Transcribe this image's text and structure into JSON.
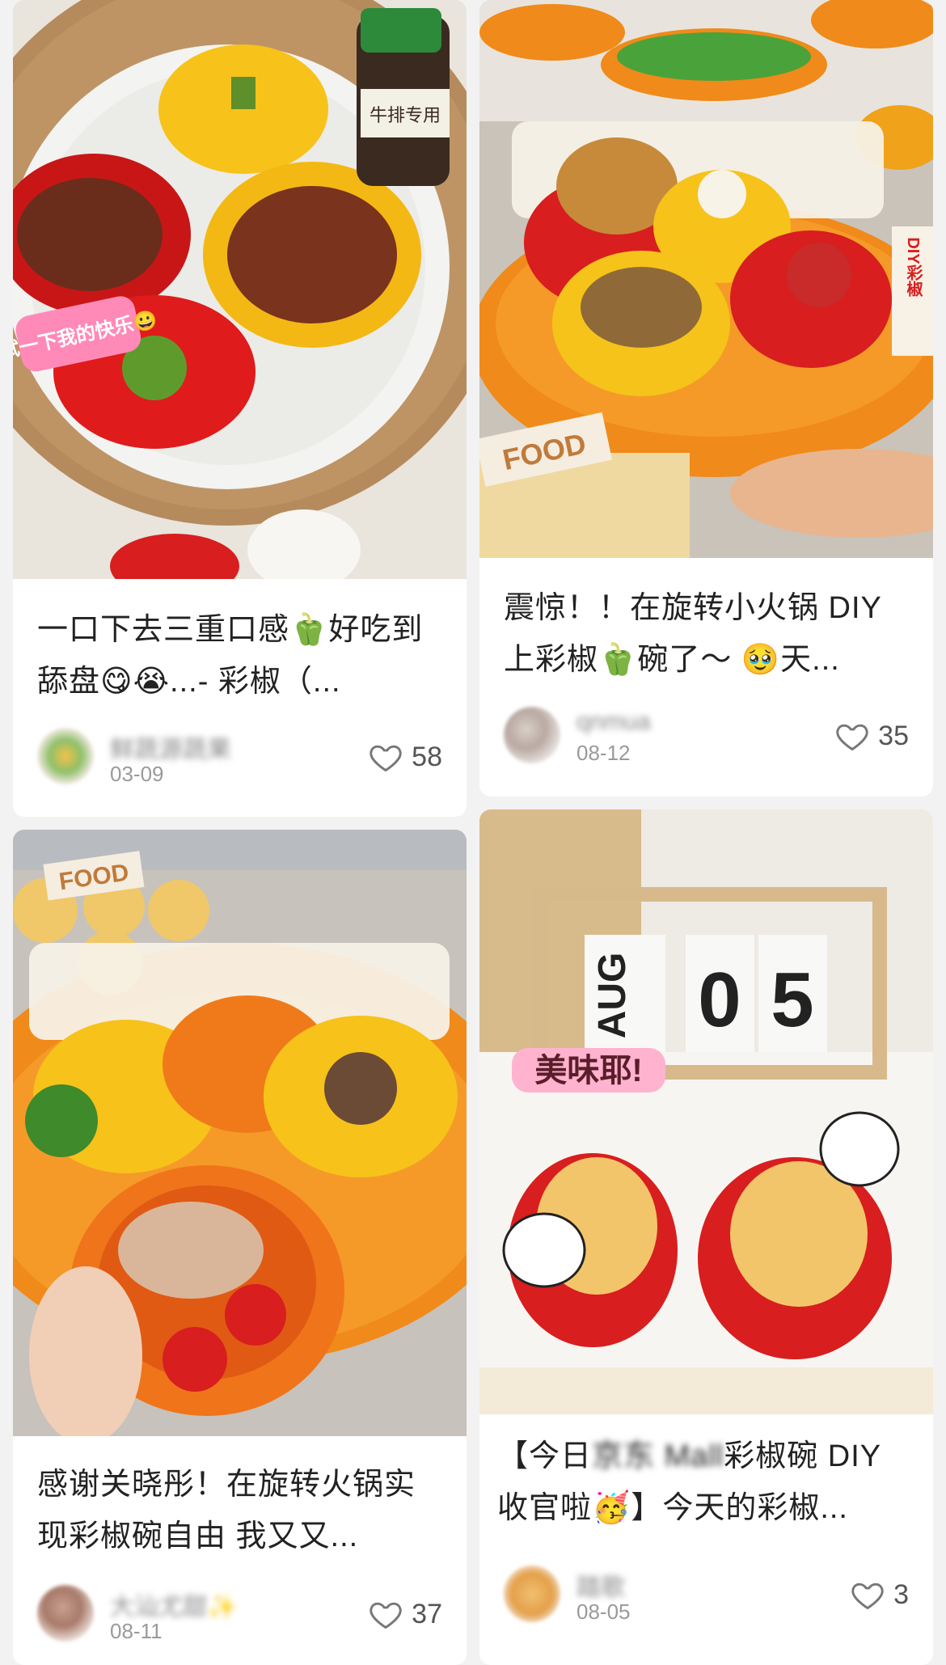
{
  "cards": [
    {
      "caption": "一口下去三重口感🫑好吃到舔盘😋😭...- 彩椒（...",
      "author": "鲜蔬源蔬果",
      "date": "03-09",
      "likes": "58",
      "overlay_text": "试一下我的快乐😀",
      "jar_label": "牛排专用"
    },
    {
      "caption": "震惊！！在旋转小火锅 DIY 上彩椒🫑碗了～ 🥹天...",
      "author": "qnmua",
      "date": "08-12",
      "likes": "35",
      "sign_text": "FOOD",
      "side_banner": "DIY彩椒"
    },
    {
      "caption": "感谢关晓彤！在旋转火锅实现彩椒碗自由 我又又...",
      "author": "大汕尤甜✨",
      "date": "08-11",
      "likes": "37",
      "sign_text": "FOOD"
    },
    {
      "caption_prefix": "【今日",
      "caption_blur": "京东 Mall",
      "caption_rest": "彩椒碗 DIY 收官啦🥳】今天的彩椒...",
      "author": "踏歌",
      "date": "08-05",
      "likes": "3",
      "calendar_month": "AUG",
      "calendar_day_1": "0",
      "calendar_day_2": "5",
      "overlay_text": "美味耶!"
    }
  ],
  "colors": {
    "red_pepper": "#d81e1e",
    "yellow_pepper": "#f7c21a",
    "orange_plate": "#f08a1a",
    "like_icon": "#777777"
  },
  "icons": [
    "heart-icon"
  ]
}
